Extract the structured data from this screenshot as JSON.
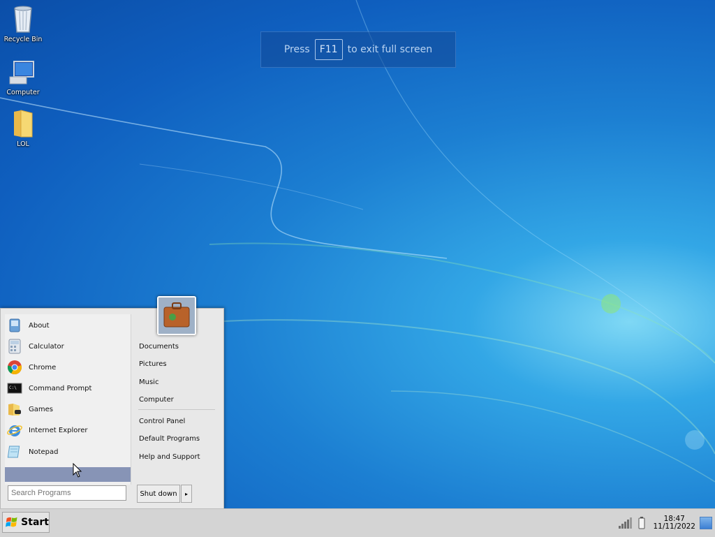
{
  "desktop": {
    "icons": [
      {
        "label": "Recycle Bin",
        "icon": "recycle-bin-icon"
      },
      {
        "label": "Computer",
        "icon": "computer-icon"
      },
      {
        "label": "LOL",
        "icon": "folder-icon"
      }
    ]
  },
  "toast": {
    "press": "Press",
    "key": "F11",
    "rest": "to exit full screen"
  },
  "start_menu": {
    "programs": [
      {
        "label": "About",
        "icon": "about-icon"
      },
      {
        "label": "Calculator",
        "icon": "calculator-icon"
      },
      {
        "label": "Chrome",
        "icon": "chrome-icon"
      },
      {
        "label": "Command Prompt",
        "icon": "command-prompt-icon"
      },
      {
        "label": "Games",
        "icon": "games-icon"
      },
      {
        "label": "Internet Explorer",
        "icon": "internet-explorer-icon"
      },
      {
        "label": "Notepad",
        "icon": "notepad-icon"
      }
    ],
    "search_placeholder": "Search Programs",
    "right_items": [
      "Documents",
      "Pictures",
      "Music",
      "Computer",
      "Control Panel",
      "Default Programs",
      "Help and Support"
    ],
    "shutdown_label": "Shut down",
    "shutdown_arrow": "▸"
  },
  "taskbar": {
    "start_label": "Start",
    "time": "18:47",
    "date": "11/11/2022"
  },
  "colors": {
    "desktop_bg": "#1c7fd2",
    "start_menu_bg": "#e8e8e8",
    "all_programs_highlight": "#8794b6",
    "taskbar_bg": "#d4d4d4"
  }
}
